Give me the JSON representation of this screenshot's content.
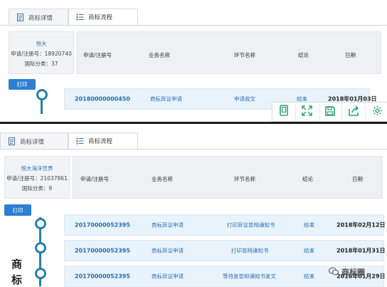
{
  "tabs": [
    {
      "label": "商标详情",
      "icon": "document-icon"
    },
    {
      "label": "商标流程",
      "icon": "list-icon"
    }
  ],
  "columns": [
    "申请/注册号",
    "业务名称",
    "环节名称",
    "结论",
    "日期"
  ],
  "panel1": {
    "card": {
      "name": "恒大",
      "reg": "申请/注册号：18920740",
      "class": "国际分类：37"
    },
    "print_label": "打印",
    "rows": [
      {
        "number": "20180000000450",
        "business": "商标异议申请",
        "step": "申请收文",
        "result": "结束",
        "date": "2018年01月03日"
      }
    ]
  },
  "panel2": {
    "card": {
      "name": "恒大海洋世界",
      "reg": "申请/注册号：21037861",
      "class": "国际分类：9"
    },
    "print_label": "打印",
    "rows": [
      {
        "number": "20170000052395",
        "business": "商标异议申请",
        "step": "打印异议答辩通知书",
        "result": "结束",
        "date": "2018年02月12日"
      },
      {
        "number": "20170000052395",
        "business": "商标异议申请",
        "step": "打印答辩通知书",
        "result": "结束",
        "date": "2018年01月31日"
      },
      {
        "number": "20170000052395",
        "business": "商标异议申请",
        "step": "等待发答辩通知书发文",
        "result": "结束",
        "date": "2018年01月29日"
      }
    ]
  },
  "toolbar": [
    "phone-icon",
    "expand-icon",
    "save-icon",
    "share-icon",
    "settings-icon"
  ],
  "side_text": [
    "商",
    "标"
  ],
  "watermark": "商标圈",
  "colors": {
    "accent": "#2a7fa8",
    "link": "#2b6cb0",
    "print": "#2d7fd1",
    "row_bg": "#e8f3fb",
    "toolbar_icon": "#2aa56a"
  }
}
